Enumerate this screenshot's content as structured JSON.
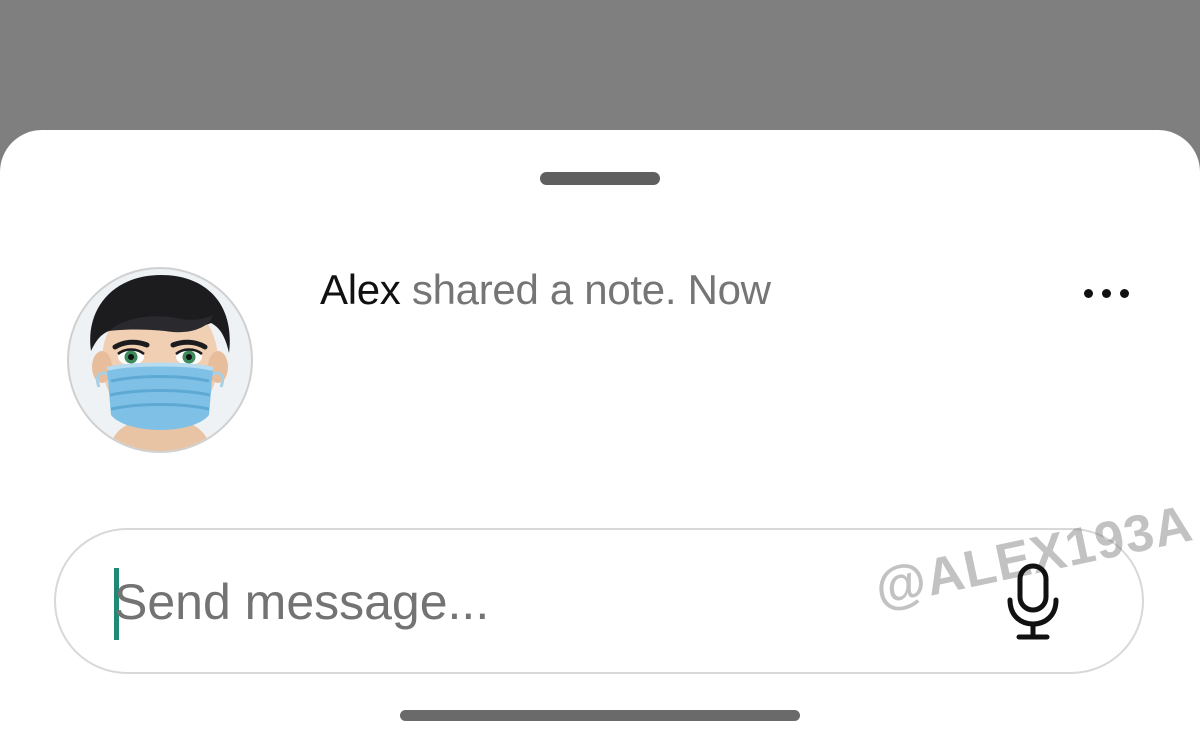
{
  "note": {
    "author": "Alex",
    "action_text": " shared a note. Now"
  },
  "avatar": {
    "icon": "masked-avatar-icon"
  },
  "more_menu": {
    "icon": "more-horizontal-icon"
  },
  "composer": {
    "placeholder": "Send message...",
    "value": "",
    "mic_icon": "microphone-icon"
  },
  "watermark": {
    "text": "@ALEX193A"
  },
  "colors": {
    "backdrop": "#7f7f7f",
    "sheet": "#ffffff",
    "caret": "#1f8a74",
    "secondary_text": "#757575"
  }
}
